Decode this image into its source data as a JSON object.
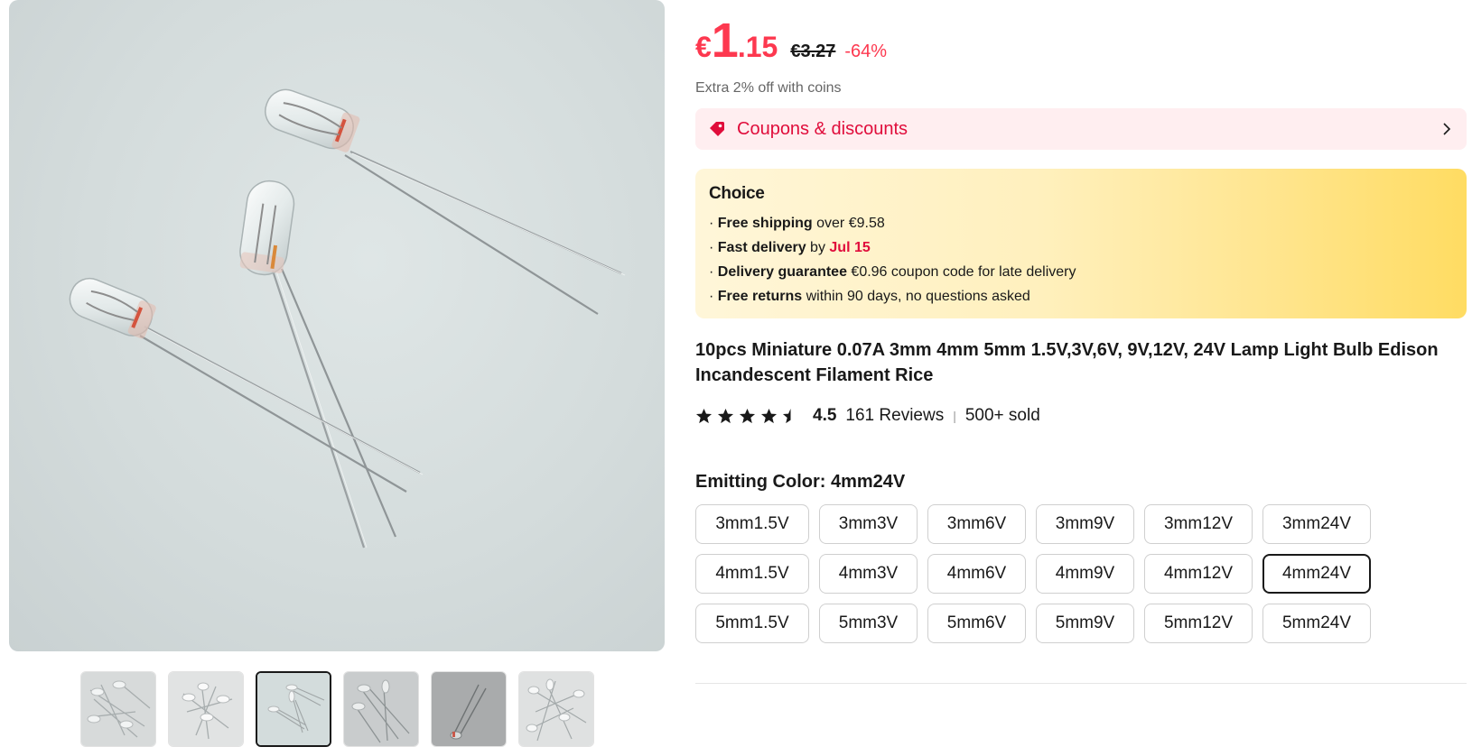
{
  "gallery": {
    "main_image_alt": "Miniature lamp bulbs",
    "thumbnails": [
      {
        "name": "thumb-1",
        "active": false
      },
      {
        "name": "thumb-2",
        "active": false
      },
      {
        "name": "thumb-3",
        "active": true
      },
      {
        "name": "thumb-4",
        "active": false
      },
      {
        "name": "thumb-5",
        "active": false
      },
      {
        "name": "thumb-6",
        "active": false
      }
    ]
  },
  "price": {
    "currency": "€",
    "integer": "1",
    "decimal": ".15",
    "original": "€3.27",
    "discount": "-64%",
    "coins_note": "Extra 2% off with coins"
  },
  "coupon": {
    "label": "Coupons & discounts",
    "icon": "tag-icon",
    "chevron": "chevron-right-icon"
  },
  "choice": {
    "title": "Choice",
    "lines": [
      {
        "bullet": "· ",
        "bold": "Free shipping",
        "text": " over €9.58"
      },
      {
        "bullet": "· ",
        "bold": "Fast delivery",
        "text": " by ",
        "highlight": "Jul 15"
      },
      {
        "bullet": "· ",
        "bold": "Delivery guarantee",
        "text": "  €0.96 coupon code for late delivery"
      },
      {
        "bullet": "· ",
        "bold": "Free returns",
        "text": "  within 90 days, no questions asked"
      }
    ]
  },
  "product": {
    "title": "10pcs Miniature 0.07A 3mm 4mm 5mm 1.5V,3V,6V, 9V,12V, 24V Lamp Light Bulb Edison Incandescent Filament Rice",
    "rating": "4.5",
    "rating_value": 4.5,
    "reviews": "161 Reviews",
    "separator": "|",
    "sold": "500+ sold"
  },
  "sku": {
    "label": "Emitting Color: 4mm24V",
    "options": [
      "3mm1.5V",
      "3mm3V",
      "3mm6V",
      "3mm9V",
      "3mm12V",
      "3mm24V",
      "4mm1.5V",
      "4mm3V",
      "4mm6V",
      "4mm9V",
      "4mm12V",
      "4mm24V",
      "5mm1.5V",
      "5mm3V",
      "5mm6V",
      "5mm9V",
      "5mm12V",
      "5mm24V"
    ],
    "selected": "4mm24V"
  },
  "colors": {
    "price_red": "#fd384f",
    "coupon_bg": "#ffeef0",
    "choice_yellow": "#ffdc62",
    "text": "#191919"
  }
}
